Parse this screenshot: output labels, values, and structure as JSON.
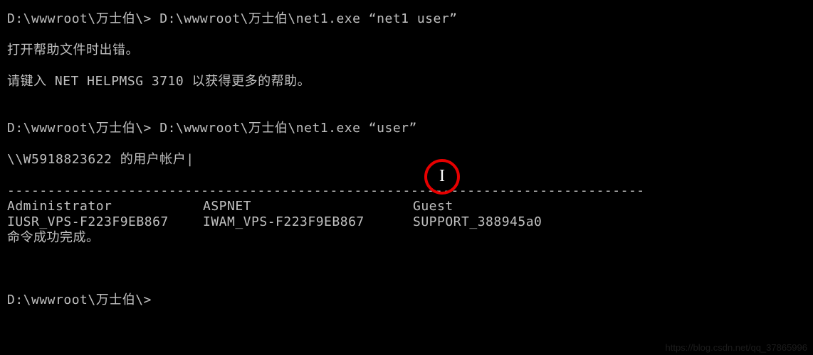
{
  "terminal": {
    "line1": {
      "prompt": "D:\\wwwroot\\万士伯\\>",
      "command": " D:\\wwwroot\\万士伯\\net1.exe “net1 user”"
    },
    "error_line": "打开帮助文件时出错。",
    "help_line": "请键入 NET HELPMSG 3710 以获得更多的帮助。",
    "line2": {
      "prompt": "D:\\wwwroot\\万士伯\\>",
      "command": " D:\\wwwroot\\万士伯\\net1.exe “user”"
    },
    "accounts_header": "\\\\W5918823622 的用户帐户",
    "caret": "|",
    "separator": "-------------------------------------------------------------------------------",
    "users_row1": {
      "c1": "Administrator",
      "c2": "ASPNET",
      "c3": "Guest"
    },
    "users_row2": {
      "c1": "IUSR_VPS-F223F9EB867",
      "c2": "IWAM_VPS-F223F9EB867",
      "c3": "SUPPORT_388945a0"
    },
    "success_line": "命令成功完成。",
    "final_prompt": "D:\\wwwroot\\万士伯\\>"
  },
  "annotation": {
    "ibeam": "I"
  },
  "watermark": "https://blog.csdn.net/qq_37865996"
}
